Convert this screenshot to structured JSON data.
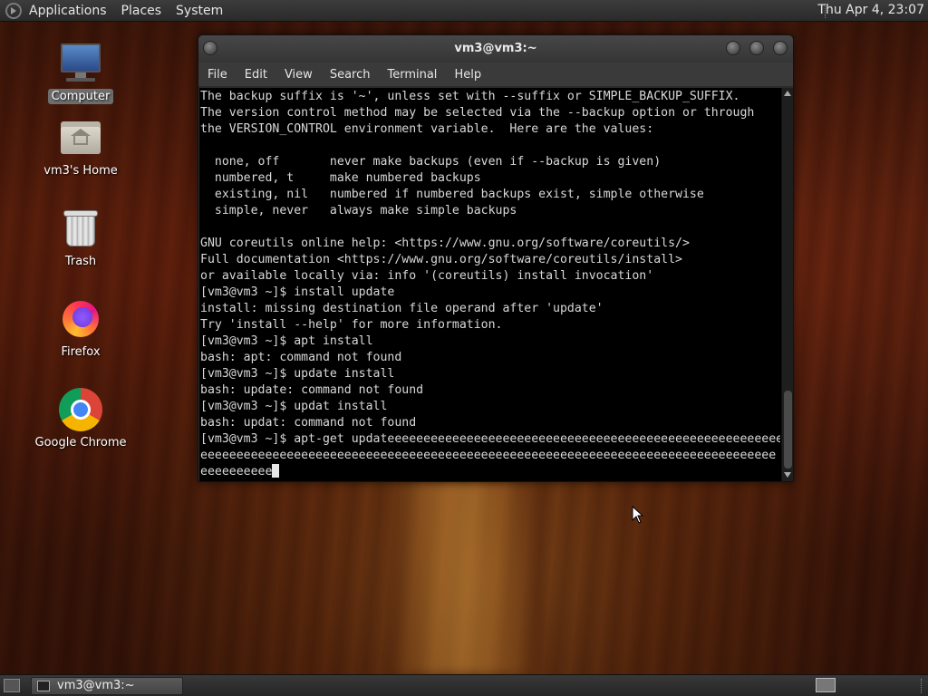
{
  "top_panel": {
    "menus": [
      "Applications",
      "Places",
      "System"
    ],
    "clock": "Thu Apr  4, 23:07"
  },
  "desktop_icons": [
    {
      "label": "Computer",
      "icon": "computer-icon"
    },
    {
      "label": "vm3's Home",
      "icon": "home-folder-icon"
    },
    {
      "label": "Trash",
      "icon": "trash-icon"
    },
    {
      "label": "Firefox",
      "icon": "firefox-icon"
    },
    {
      "label": "Google Chrome",
      "icon": "chrome-icon"
    }
  ],
  "terminal": {
    "title": "vm3@vm3:~",
    "menu": [
      "File",
      "Edit",
      "View",
      "Search",
      "Terminal",
      "Help"
    ],
    "lines": [
      "The backup suffix is '~', unless set with --suffix or SIMPLE_BACKUP_SUFFIX.",
      "The version control method may be selected via the --backup option or through",
      "the VERSION_CONTROL environment variable.  Here are the values:",
      "",
      "  none, off       never make backups (even if --backup is given)",
      "  numbered, t     make numbered backups",
      "  existing, nil   numbered if numbered backups exist, simple otherwise",
      "  simple, never   always make simple backups",
      "",
      "GNU coreutils online help: <https://www.gnu.org/software/coreutils/>",
      "Full documentation <https://www.gnu.org/software/coreutils/install>",
      "or available locally via: info '(coreutils) install invocation'",
      "[vm3@vm3 ~]$ install update",
      "install: missing destination file operand after 'update'",
      "Try 'install --help' for more information.",
      "[vm3@vm3 ~]$ apt install",
      "bash: apt: command not found",
      "[vm3@vm3 ~]$ update install",
      "bash: update: command not found",
      "[vm3@vm3 ~]$ updat install",
      "bash: updat: command not found",
      "[vm3@vm3 ~]$ apt-get updateeeeeeeeeeeeeeeeeeeeeeeeeeeeeeeeeeeeeeeeeeeeeeeeeeeeeeeeee",
      "eeeeeeeeeeeeeeeeeeeeeeeeeeeeeeeeeeeeeeeeeeeeeeeeeeeeeeeeeeeeeeeeeeeeeeeeeeeeeeee",
      "eeeeeeeeee"
    ]
  },
  "taskbar": {
    "window_button": "vm3@vm3:~"
  }
}
